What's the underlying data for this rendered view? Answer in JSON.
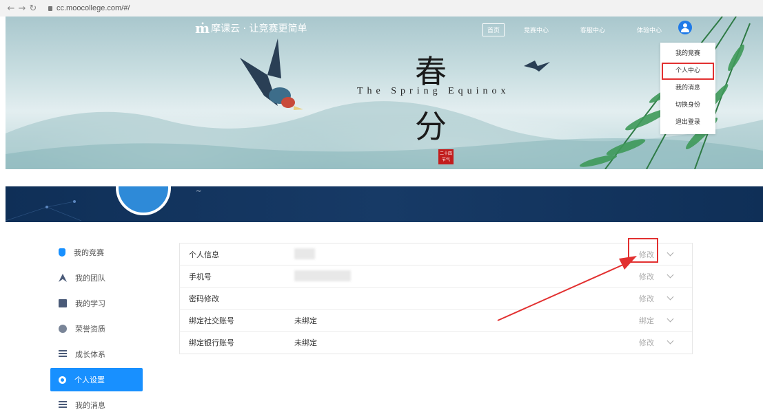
{
  "browser": {
    "url": "cc.moocollege.com/#/",
    "back_icon": "arrow-left-icon",
    "forward_icon": "arrow-right-icon",
    "reload_icon": "reload-icon"
  },
  "header": {
    "logo_mark": "ṁ",
    "logo_text": "摩课云 · 让竞赛更简单",
    "nav": [
      "首页",
      "竞赛中心",
      "客服中心",
      "体验中心"
    ],
    "user_icon": "user-avatar-icon"
  },
  "user_menu": {
    "items": [
      "我的竞赛",
      "个人中心",
      "我的消息",
      "切换身份",
      "退出登录"
    ],
    "highlighted": "个人中心"
  },
  "banner": {
    "char_top": "春",
    "subtitle": "The Spring Equinox",
    "char_bottom": "分",
    "seal_line1": "二十四",
    "seal_line2": "节气"
  },
  "profile": {
    "name_placeholder": "~"
  },
  "sidebar": {
    "items": [
      {
        "label": "我的竞赛",
        "icon": "trophy-icon"
      },
      {
        "label": "我的团队",
        "icon": "flag-icon"
      },
      {
        "label": "我的学习",
        "icon": "book-icon"
      },
      {
        "label": "荣誉资质",
        "icon": "medal-icon"
      },
      {
        "label": "成长体系",
        "icon": "growth-icon"
      },
      {
        "label": "个人设置",
        "icon": "settings-icon"
      },
      {
        "label": "我的消息",
        "icon": "message-icon"
      }
    ],
    "active": "个人设置"
  },
  "settings": {
    "rows": [
      {
        "label": "个人信息",
        "value": "",
        "action": "修改"
      },
      {
        "label": "手机号",
        "value": "",
        "action": "修改"
      },
      {
        "label": "密码修改",
        "value": "",
        "action": "修改"
      },
      {
        "label": "绑定社交账号",
        "value": "未绑定",
        "action": "绑定"
      },
      {
        "label": "绑定银行账号",
        "value": "未绑定",
        "action": "修改"
      }
    ]
  },
  "colors": {
    "accent": "#1890ff",
    "highlight_red": "#e23030",
    "strip_dark": "#0f2f57"
  }
}
